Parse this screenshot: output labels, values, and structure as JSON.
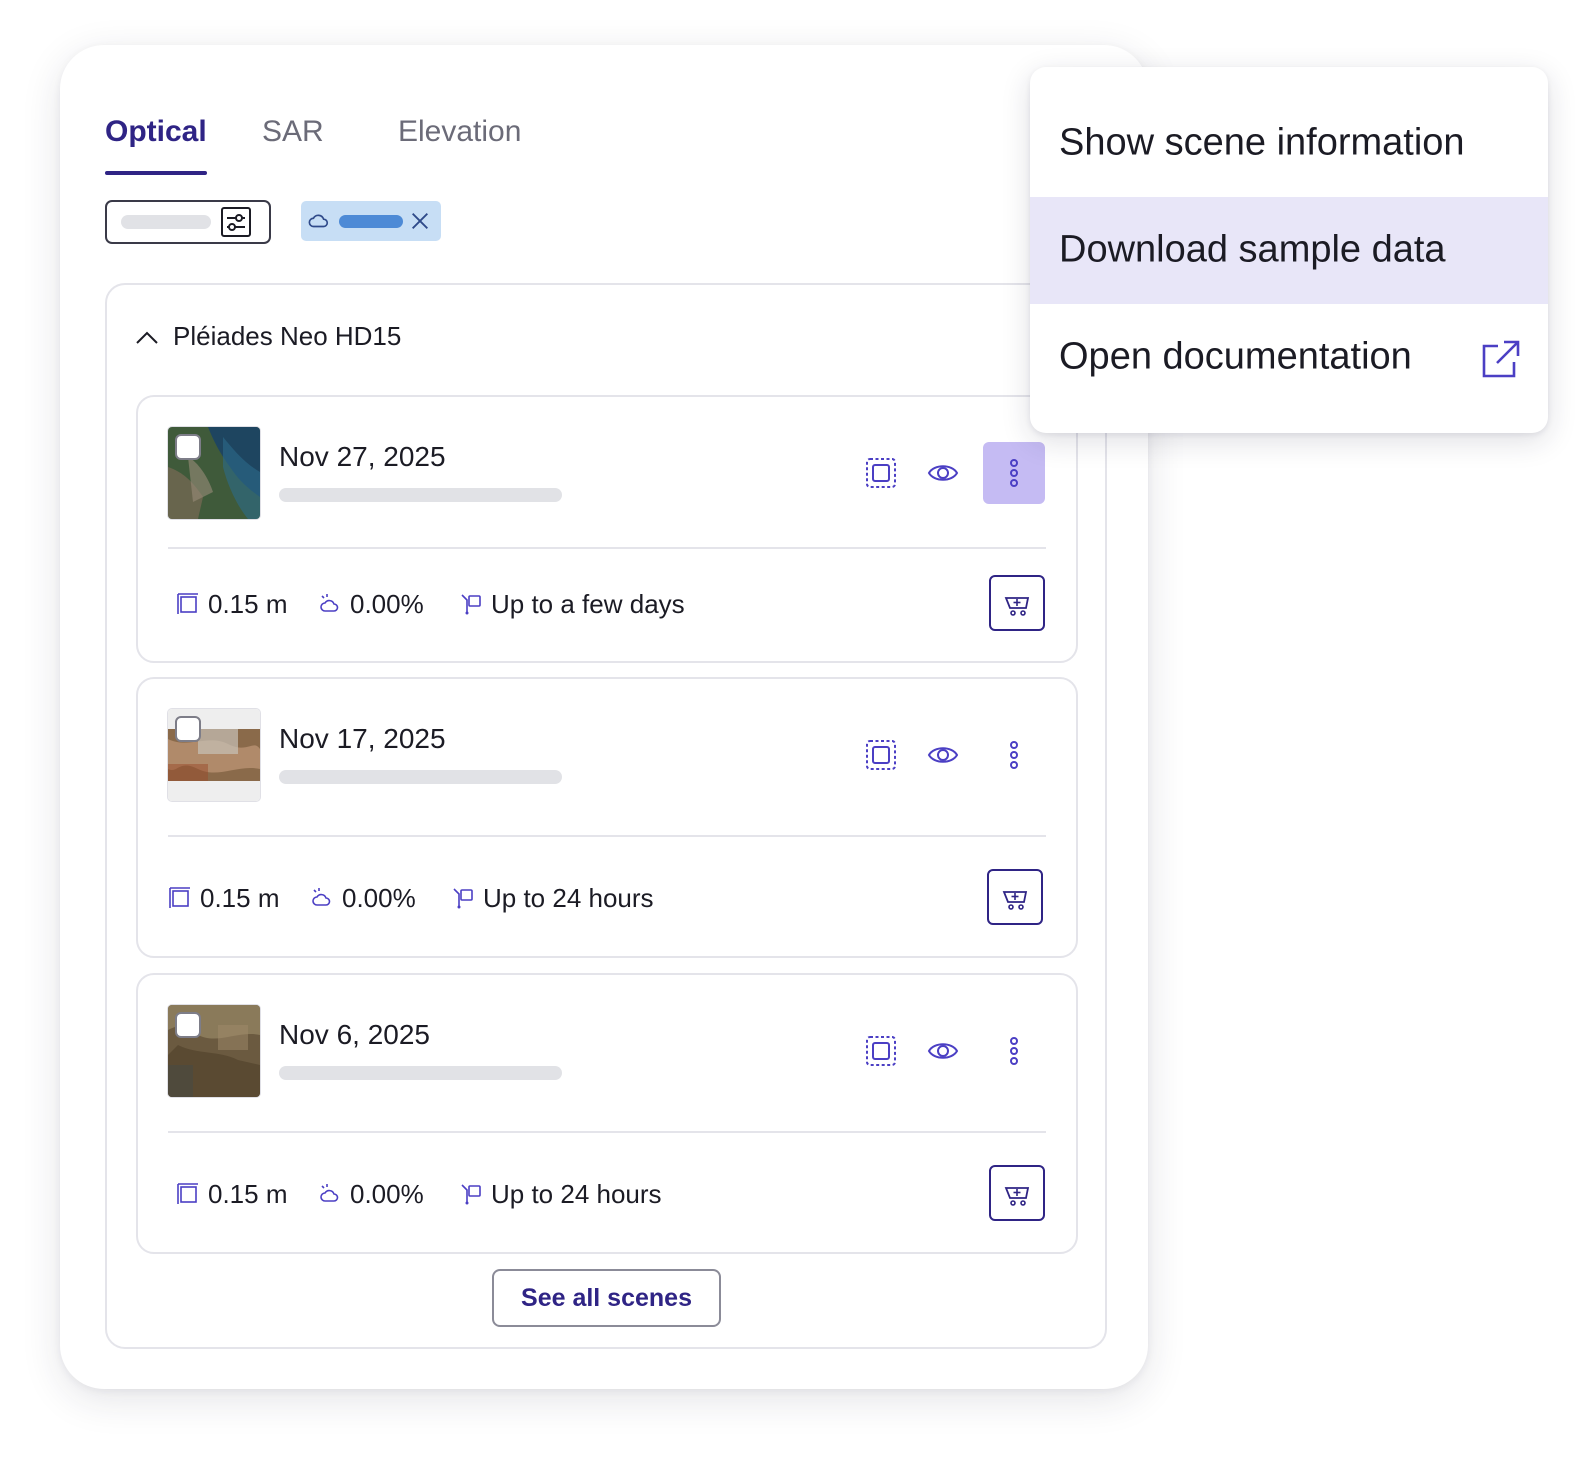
{
  "tabs": [
    {
      "label": "Optical",
      "active": true
    },
    {
      "label": "SAR",
      "active": false
    },
    {
      "label": "Elevation",
      "active": false
    }
  ],
  "filters": {
    "search_icon": "settings-sliders-icon",
    "chip_icon": "cloud-icon",
    "chip_close_icon": "close-icon"
  },
  "group": {
    "title": "Pléiades Neo HD15",
    "expanded": true
  },
  "scenes": [
    {
      "date": "Nov 27, 2025",
      "resolution": "0.15 m",
      "cloud": "0.00%",
      "delivery": "Up to a few days",
      "menu_open": true
    },
    {
      "date": "Nov 17, 2025",
      "resolution": "0.15 m",
      "cloud": "0.00%",
      "delivery": "Up to 24 hours",
      "menu_open": false
    },
    {
      "date": "Nov 6, 2025",
      "resolution": "0.15 m",
      "cloud": "0.00%",
      "delivery": "Up to 24 hours",
      "menu_open": false
    }
  ],
  "see_all_label": "See all scenes",
  "context_menu": {
    "items": [
      {
        "label": "Show scene information",
        "highlighted": false
      },
      {
        "label": "Download sample data",
        "highlighted": true
      },
      {
        "label": "Open documentation",
        "highlighted": false,
        "icon": "external-link-icon"
      }
    ]
  },
  "colors": {
    "accent": "#2f2485",
    "icon": "#4b3fc4",
    "menu_highlight": "#e8e6f8",
    "active_more_button": "#c5bbf3",
    "chip": "#c7def5",
    "chip_bar": "#4d8ad6"
  }
}
